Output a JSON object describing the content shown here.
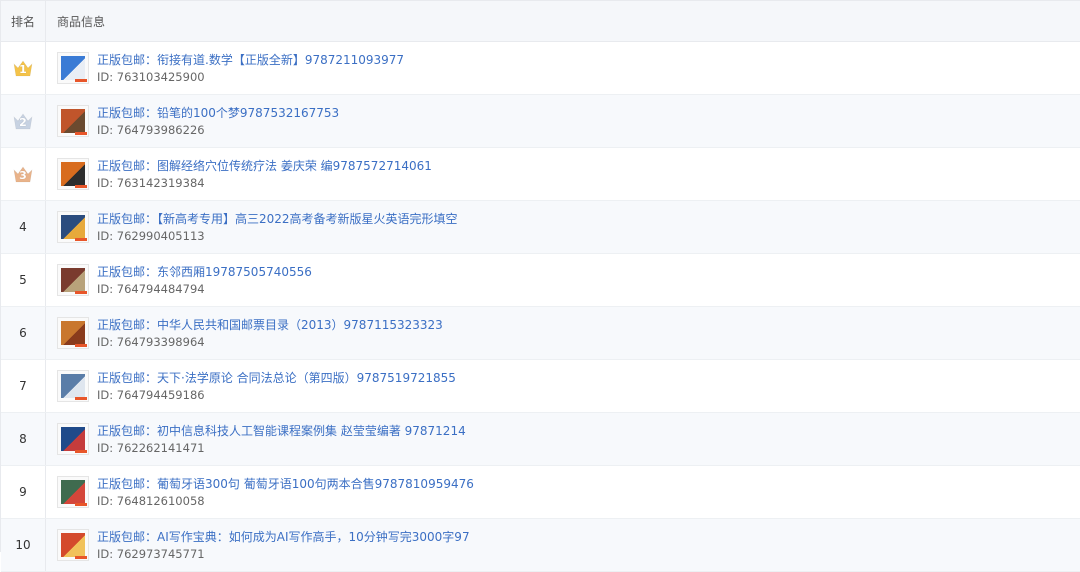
{
  "header": {
    "rank": "排名",
    "info": "商品信息"
  },
  "colors": {
    "link": "#3b6fc4",
    "gold": "#f4c34a",
    "silver": "#c7d2e2",
    "bronze": "#e9b38a"
  },
  "rows": [
    {
      "rank": "1",
      "medal": "gold",
      "title": "正版包邮：衔接有道.数学【正版全新】9787211093977",
      "id": "ID: 763103425900"
    },
    {
      "rank": "2",
      "medal": "silver",
      "title": "正版包邮：铅笔的100个梦9787532167753",
      "id": "ID: 764793986226"
    },
    {
      "rank": "3",
      "medal": "bronze",
      "title": "正版包邮：图解经络穴位传统疗法 姜庆荣 编9787572714061",
      "id": "ID: 763142319384"
    },
    {
      "rank": "4",
      "medal": "",
      "title": "正版包邮：【新高考专用】高三2022高考备考新版星火英语完形填空",
      "id": "ID: 762990405113"
    },
    {
      "rank": "5",
      "medal": "",
      "title": "正版包邮：东邻西厢19787505740556",
      "id": "ID: 764794484794"
    },
    {
      "rank": "6",
      "medal": "",
      "title": "正版包邮：中华人民共和国邮票目录（2013）9787115323323",
      "id": "ID: 764793398964"
    },
    {
      "rank": "7",
      "medal": "",
      "title": "正版包邮：天下·法学原论 合同法总论（第四版）9787519721855",
      "id": "ID: 764794459186"
    },
    {
      "rank": "8",
      "medal": "",
      "title": "正版包邮：初中信息科技人工智能课程案例集 赵莹莹编著 97871214",
      "id": "ID: 762262141471"
    },
    {
      "rank": "9",
      "medal": "",
      "title": "正版包邮：葡萄牙语300句 葡萄牙语100句两本合售9787810959476",
      "id": "ID: 764812610058"
    },
    {
      "rank": "10",
      "medal": "",
      "title": "正版包邮：AI写作宝典：如何成为AI写作高手，10分钟写完3000字97",
      "id": "ID: 762973745771"
    }
  ]
}
